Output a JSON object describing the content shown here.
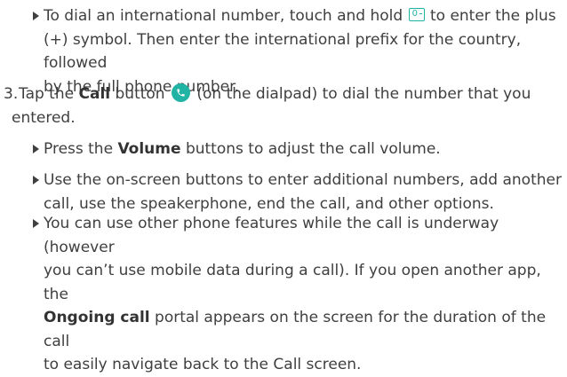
{
  "b1": {
    "pre": "To dial an international number, touch and hold",
    "key_label": "0",
    "post1": " to enter the plus",
    "line2": "(+) symbol. Then enter the international prefix for the country, followed",
    "line3": "by the full phone number."
  },
  "step3": {
    "number": "3.",
    "pre": "Tap the ",
    "bold": "Call",
    "mid": " button ",
    "post": " (on the dialpad) to dial the number that you",
    "line2": "entered."
  },
  "b2": {
    "pre": "Press the ",
    "bold": "Volume",
    "post": " buttons to adjust the call volume."
  },
  "b3": {
    "line1": "Use the on-screen buttons to enter additional numbers, add another",
    "line2": "call, use the speakerphone, end the call, and other options."
  },
  "b4": {
    "line1": "You can use other phone features while the call is underway (however",
    "line2": "you can’t use mobile data during a call). If you open another app, the",
    "bold": "Ongoing call",
    "line3_post": " portal appears on the screen for the duration of the call",
    "line4": "to easily navigate back to the Call screen."
  },
  "colors": {
    "accent": "#21b3a4",
    "text": "#3f3f3f"
  },
  "icons": {
    "bullet": "right-triangle-icon",
    "call": "phone-icon",
    "key": "zero-plus-key-icon"
  }
}
